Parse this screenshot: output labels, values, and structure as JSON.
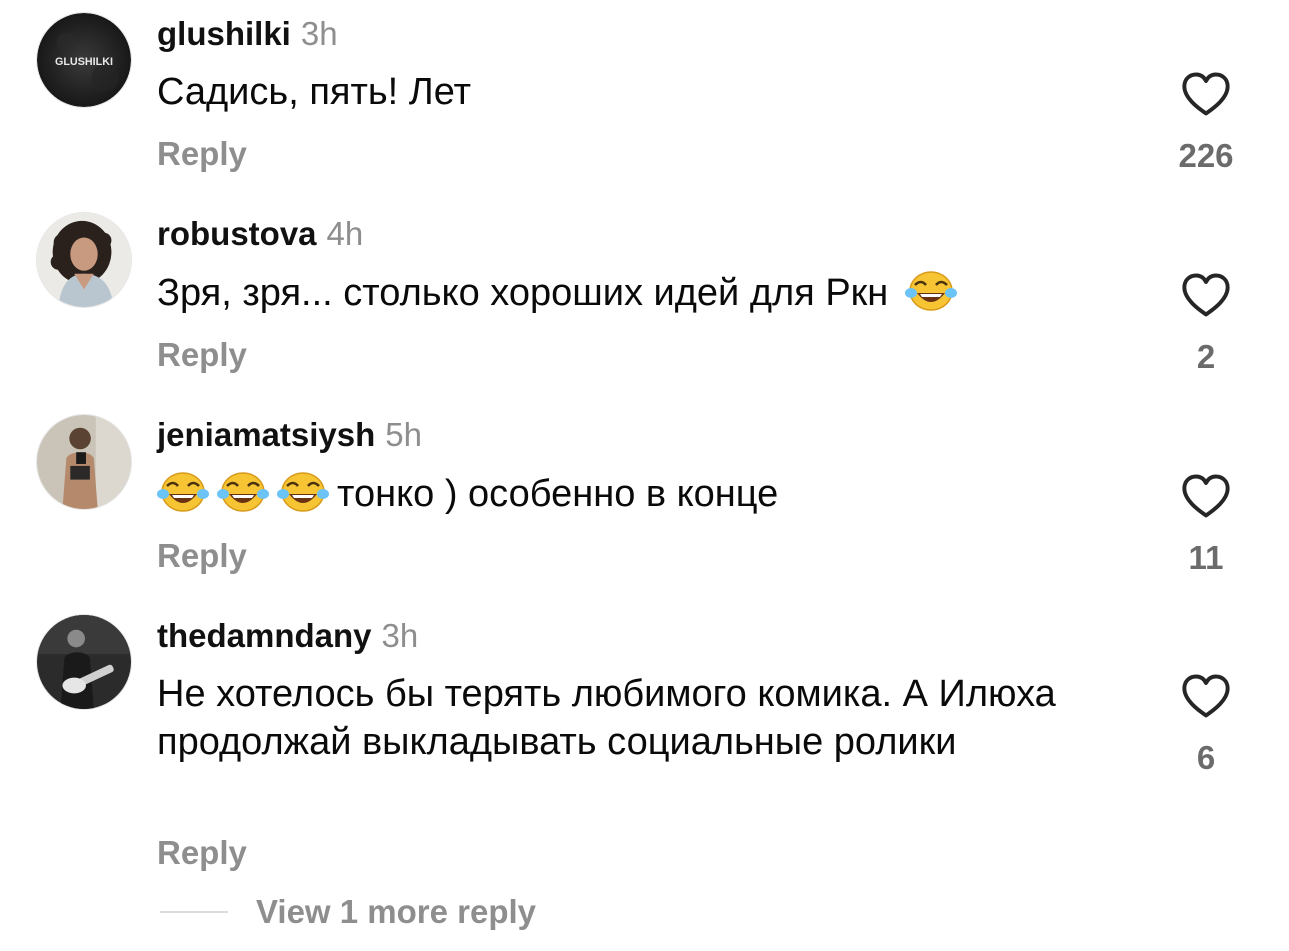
{
  "comments": [
    {
      "username": "glushilki",
      "time": "3h",
      "text": "Садись, пять! Лет",
      "reply_label": "Reply",
      "like_count": "226",
      "avatar_text": "GLUSHILKI"
    },
    {
      "username": "robustova",
      "time": "4h",
      "text": "Зря, зря... столько хороших идей для Ркн",
      "reply_label": "Reply",
      "like_count": "2"
    },
    {
      "username": "jeniamatsiysh",
      "time": "5h",
      "text": "тонко ) особенно в конце",
      "reply_label": "Reply",
      "like_count": "11"
    },
    {
      "username": "thedamndany",
      "time": "3h",
      "text": "Не хотелось бы терять любимого комика. А Илюха продолжай выкладывать социальные ролики",
      "reply_label": "Reply",
      "like_count": "6"
    }
  ],
  "view_more": {
    "label": "View 1 more reply"
  },
  "icons": {
    "like": "heart-outline-icon",
    "emoji": "face-with-tears-of-joy-emoji"
  },
  "colors": {
    "text": "#000000",
    "secondary": "#8e8e8e",
    "count": "#6b6b6b"
  }
}
